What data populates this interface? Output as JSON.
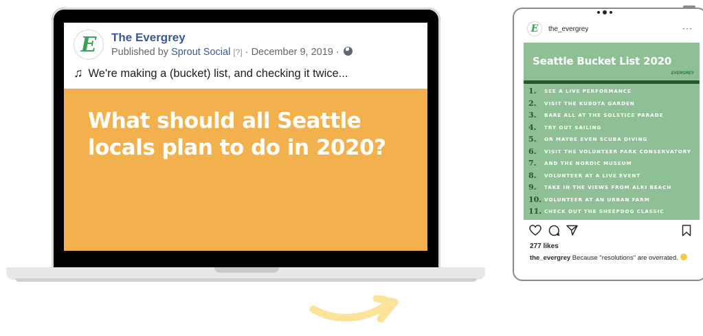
{
  "facebook_post": {
    "page_name": "The Evergrey",
    "published_by_prefix": "Published by ",
    "publisher": "Sprout Social",
    "help_marker": "[?]",
    "date_separator": " · December 9, 2019 · ",
    "message_icon": "music-note-icon",
    "message": "We're making a (bucket) list, and checking it twice...",
    "image_text": "What should all Seattle locals plan to do in 2020?",
    "avatar_letter": "E",
    "image_background": "#f2b14c",
    "link_color": "#385898"
  },
  "instagram_post": {
    "username": "the_evergrey",
    "more_label": "···",
    "avatar_letter": "E",
    "title": "Seattle Bucket List 2020",
    "brand": "EVERGREY",
    "items": [
      {
        "num": "1.",
        "text": "SEE A LIVE PERFORMANCE"
      },
      {
        "num": "2.",
        "text": "VISIT THE KUBOTA GARDEN"
      },
      {
        "num": "3.",
        "text": "BARE ALL AT THE SOLSTICE PARADE"
      },
      {
        "num": "4.",
        "text": "TRY OUT SAILING"
      },
      {
        "num": "5.",
        "text": "OR MAYBE EVEN SCUBA DIVING"
      },
      {
        "num": "6.",
        "text": "VISIT THE VOLUNTEER PARK CONSERVATORY"
      },
      {
        "num": "7.",
        "text": "AND THE NORDIC MUSEUM"
      },
      {
        "num": "8.",
        "text": "VOLUNTEER AT A LIVE EVENT"
      },
      {
        "num": "9.",
        "text": "TAKE IN THE VIEWS FROM ALKI BEACH"
      },
      {
        "num": "10.",
        "text": "VOLUNTEER AT AN URBAN FARM"
      },
      {
        "num": "11.",
        "text": "CHECK OUT THE SHEEPDOG CLASSIC"
      }
    ],
    "likes": "277 likes",
    "caption_user": "the_evergrey",
    "caption_text": " Because \"resolutions\" are overrated. ",
    "image_background": "#8fbf95",
    "accent_dark": "#1f5a31"
  },
  "decor": {
    "arrow_color": "#fbe49a"
  }
}
